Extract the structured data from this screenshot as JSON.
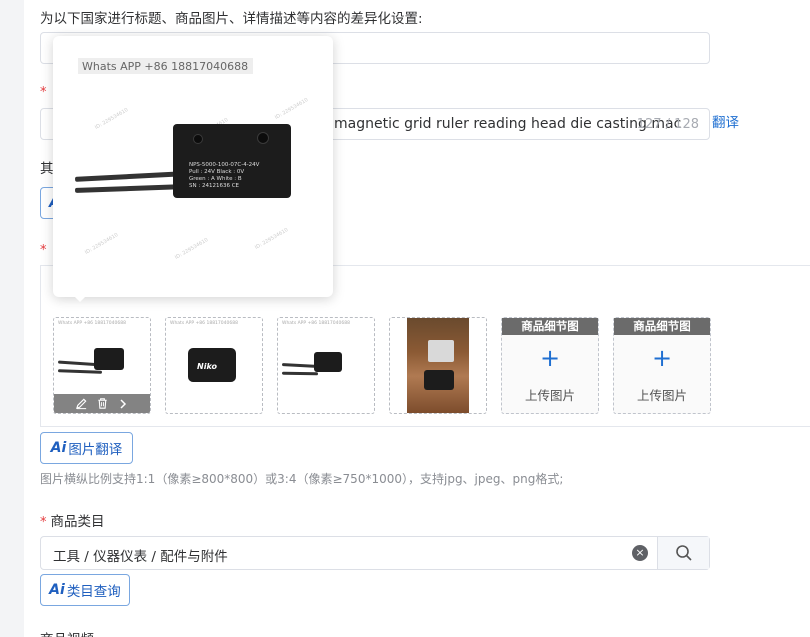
{
  "section": {
    "diff_settings_label": "为以下国家进行标题、商品图片、详情描述等内容的差异化设置:"
  },
  "title_field": {
    "value": "magnetic grid ruler reading head die casting mac",
    "counter": "127 / 128",
    "translate_link": "翻译"
  },
  "other_label_partial": "其",
  "popup": {
    "watermark": "Whats APP +86 18817040688",
    "sensor_lines": [
      "NPS-5000-100-07C-4-24V",
      "Pull : 24V     Black : 0V",
      "Green : A      White : B",
      "SN : 24121636     CE"
    ]
  },
  "images": {
    "thumb_watermark": "Whats APP +86 18817040688",
    "brand_text": "Niko",
    "upload_slots": [
      {
        "header": "商品细节图",
        "label": "上传图片"
      },
      {
        "header": "商品细节图",
        "label": "上传图片"
      }
    ],
    "translate_button": "图片翻译",
    "hint": "图片横纵比例支持1:1（像素≥800*800）或3:4（像素≥750*1000），支持jpg、jpeg、png格式;"
  },
  "category": {
    "label": "商品类目",
    "value": "工具 / 仪器仪表 / 配件与附件",
    "query_button": "类目查询"
  },
  "video": {
    "label": "商品视频"
  },
  "ai_mark": "Ai",
  "colors": {
    "accent": "#1f6fd1",
    "required": "#e4393c"
  },
  "icons": [
    "edit-icon",
    "trash-icon",
    "chevron-right-icon",
    "clear-icon",
    "search-icon",
    "plus-icon"
  ]
}
